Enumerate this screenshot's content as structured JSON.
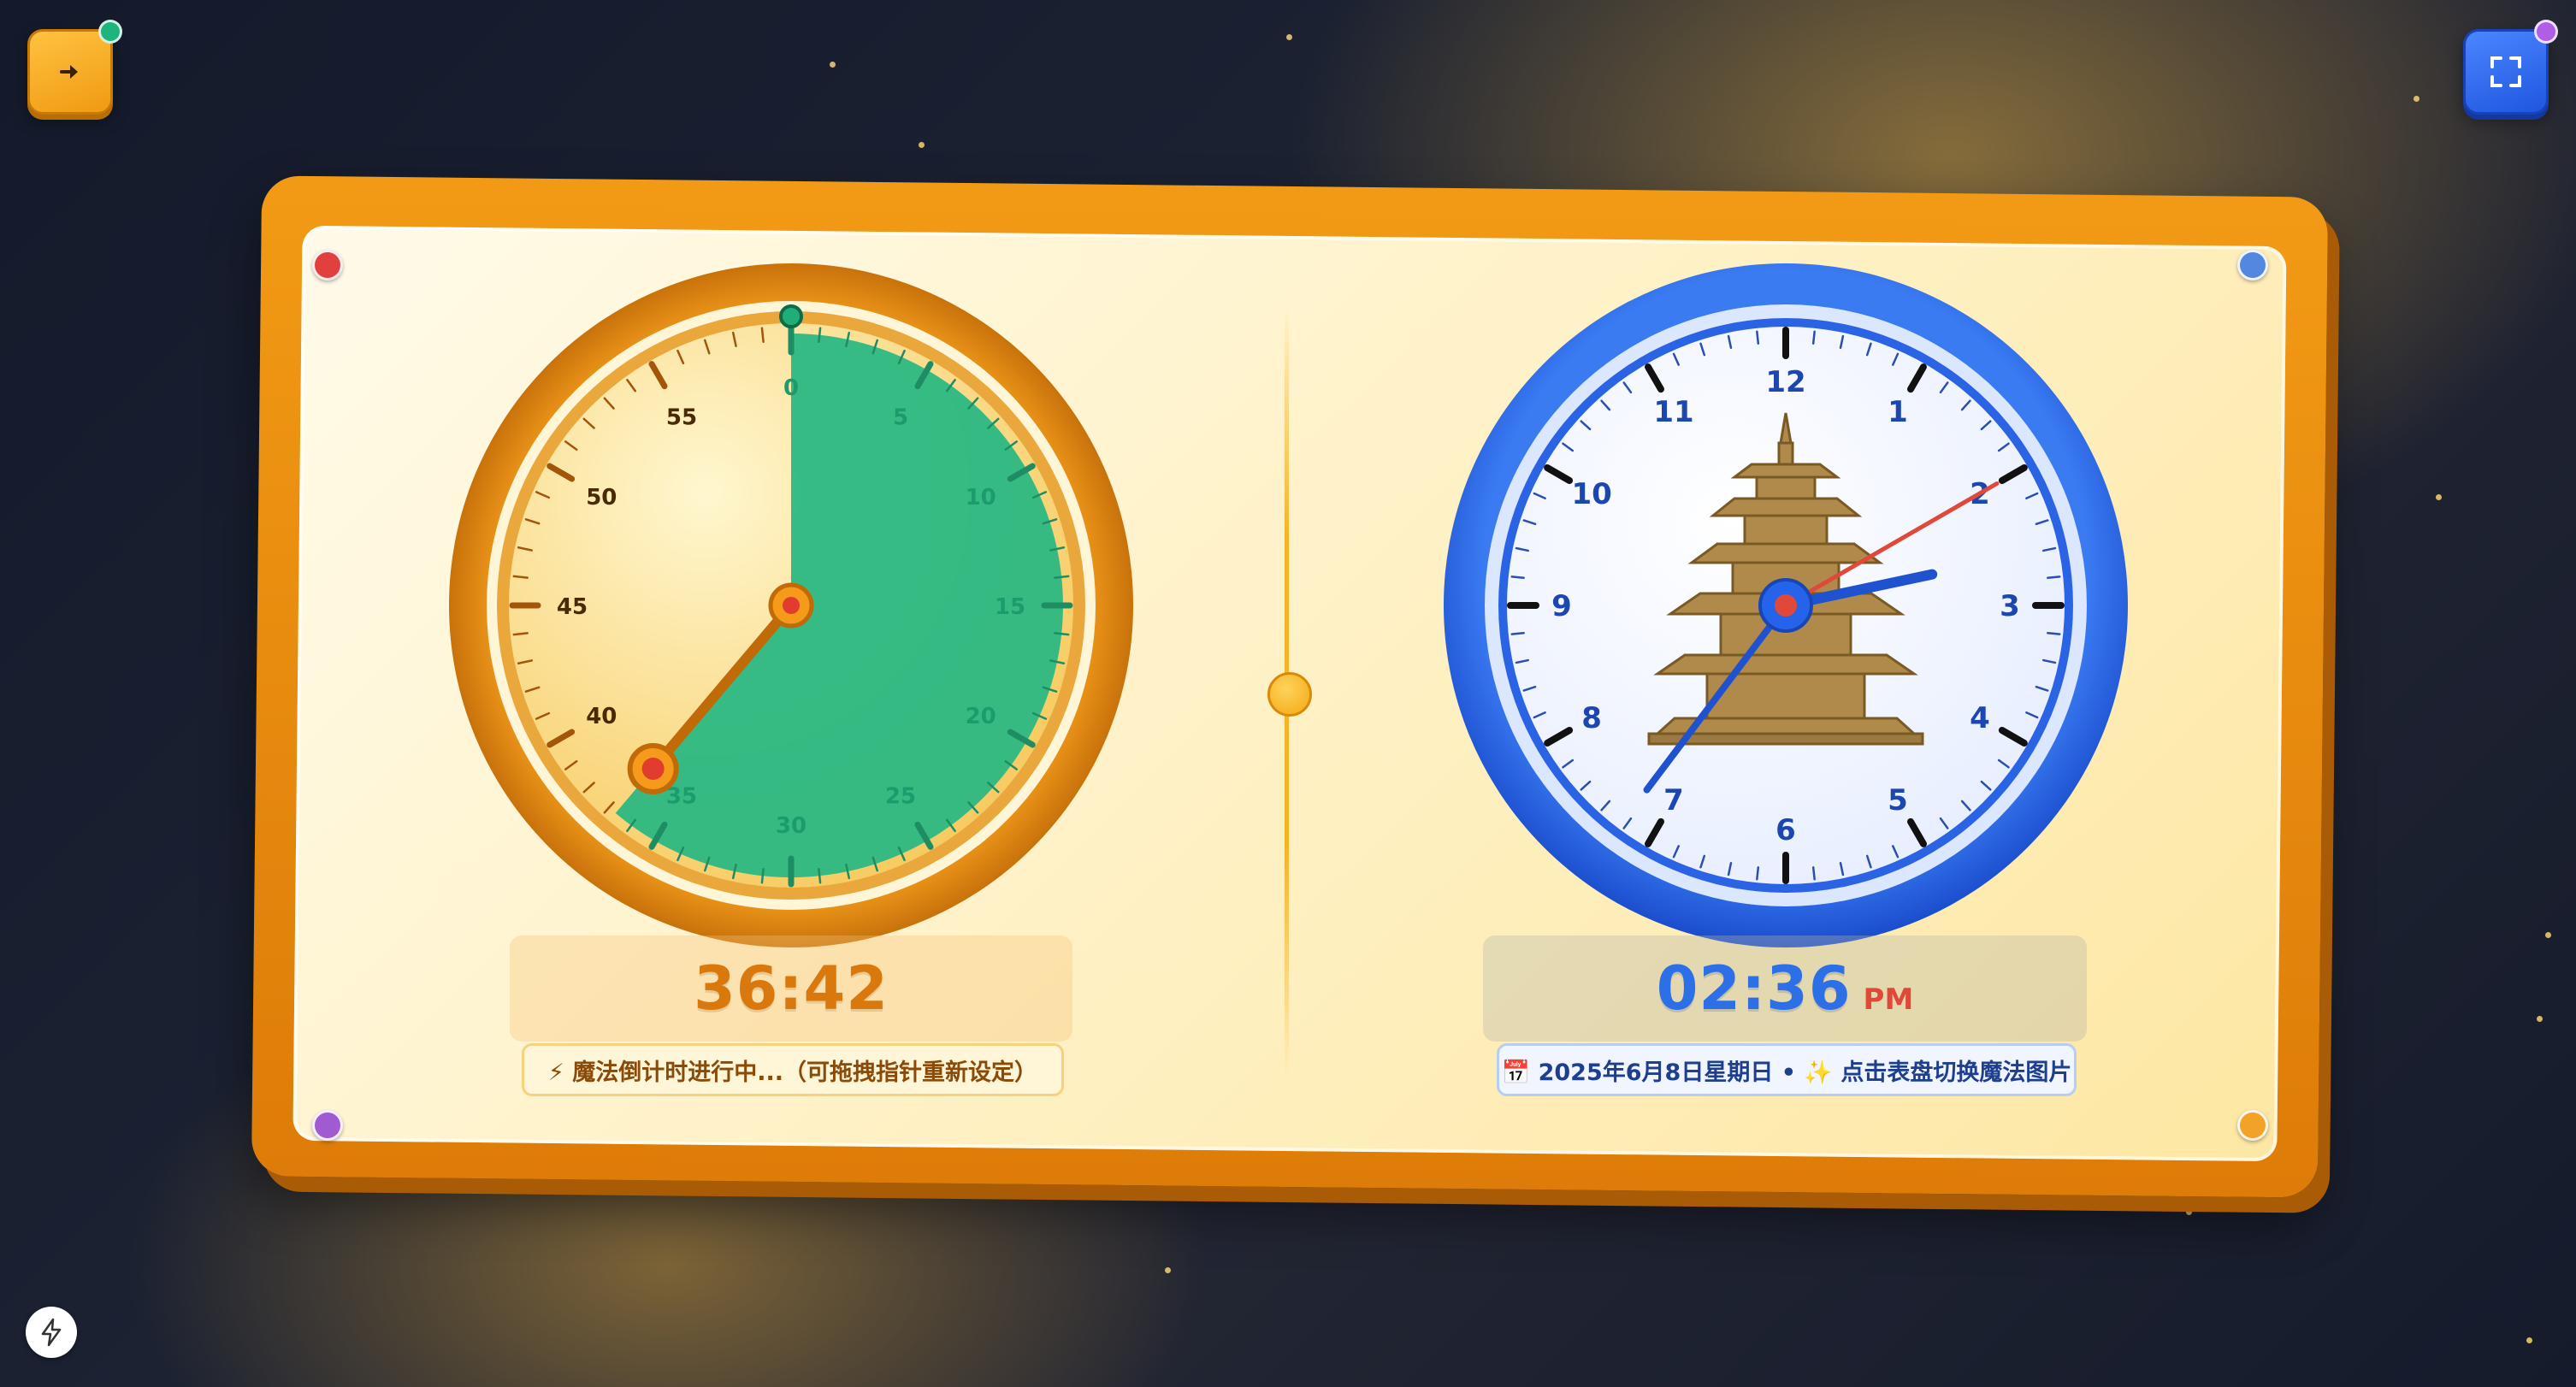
{
  "toolbar": {
    "back_icon": "arrow-right-icon",
    "fullscreen_icon": "fullscreen-icon",
    "bolt_icon": "lightning-bolt-icon"
  },
  "timer": {
    "display": "36:42",
    "status": "⚡ 魔法倒计时进行中...（可拖拽指针重新设定）",
    "dial_labels": [
      "0",
      "5",
      "10",
      "15",
      "20",
      "25",
      "30",
      "35",
      "40",
      "45",
      "50",
      "55"
    ],
    "remaining_minutes": 36.7,
    "accent_color": "#2bb883"
  },
  "clock": {
    "display": "02:36",
    "ampm": "PM",
    "status": "📅 2025年6月8日星期日 • ✨ 点击表盘切换魔法图片",
    "dial_numbers": [
      "12",
      "1",
      "2",
      "3",
      "4",
      "5",
      "6",
      "7",
      "8",
      "9",
      "10",
      "11"
    ],
    "hour": 2,
    "minute": 36,
    "second": 10,
    "face_image": "pagoda-image",
    "accent_color": "#2563eb"
  },
  "colors": {
    "orange": "#f29a15",
    "blue": "#2563eb",
    "red": "#e0483a"
  }
}
